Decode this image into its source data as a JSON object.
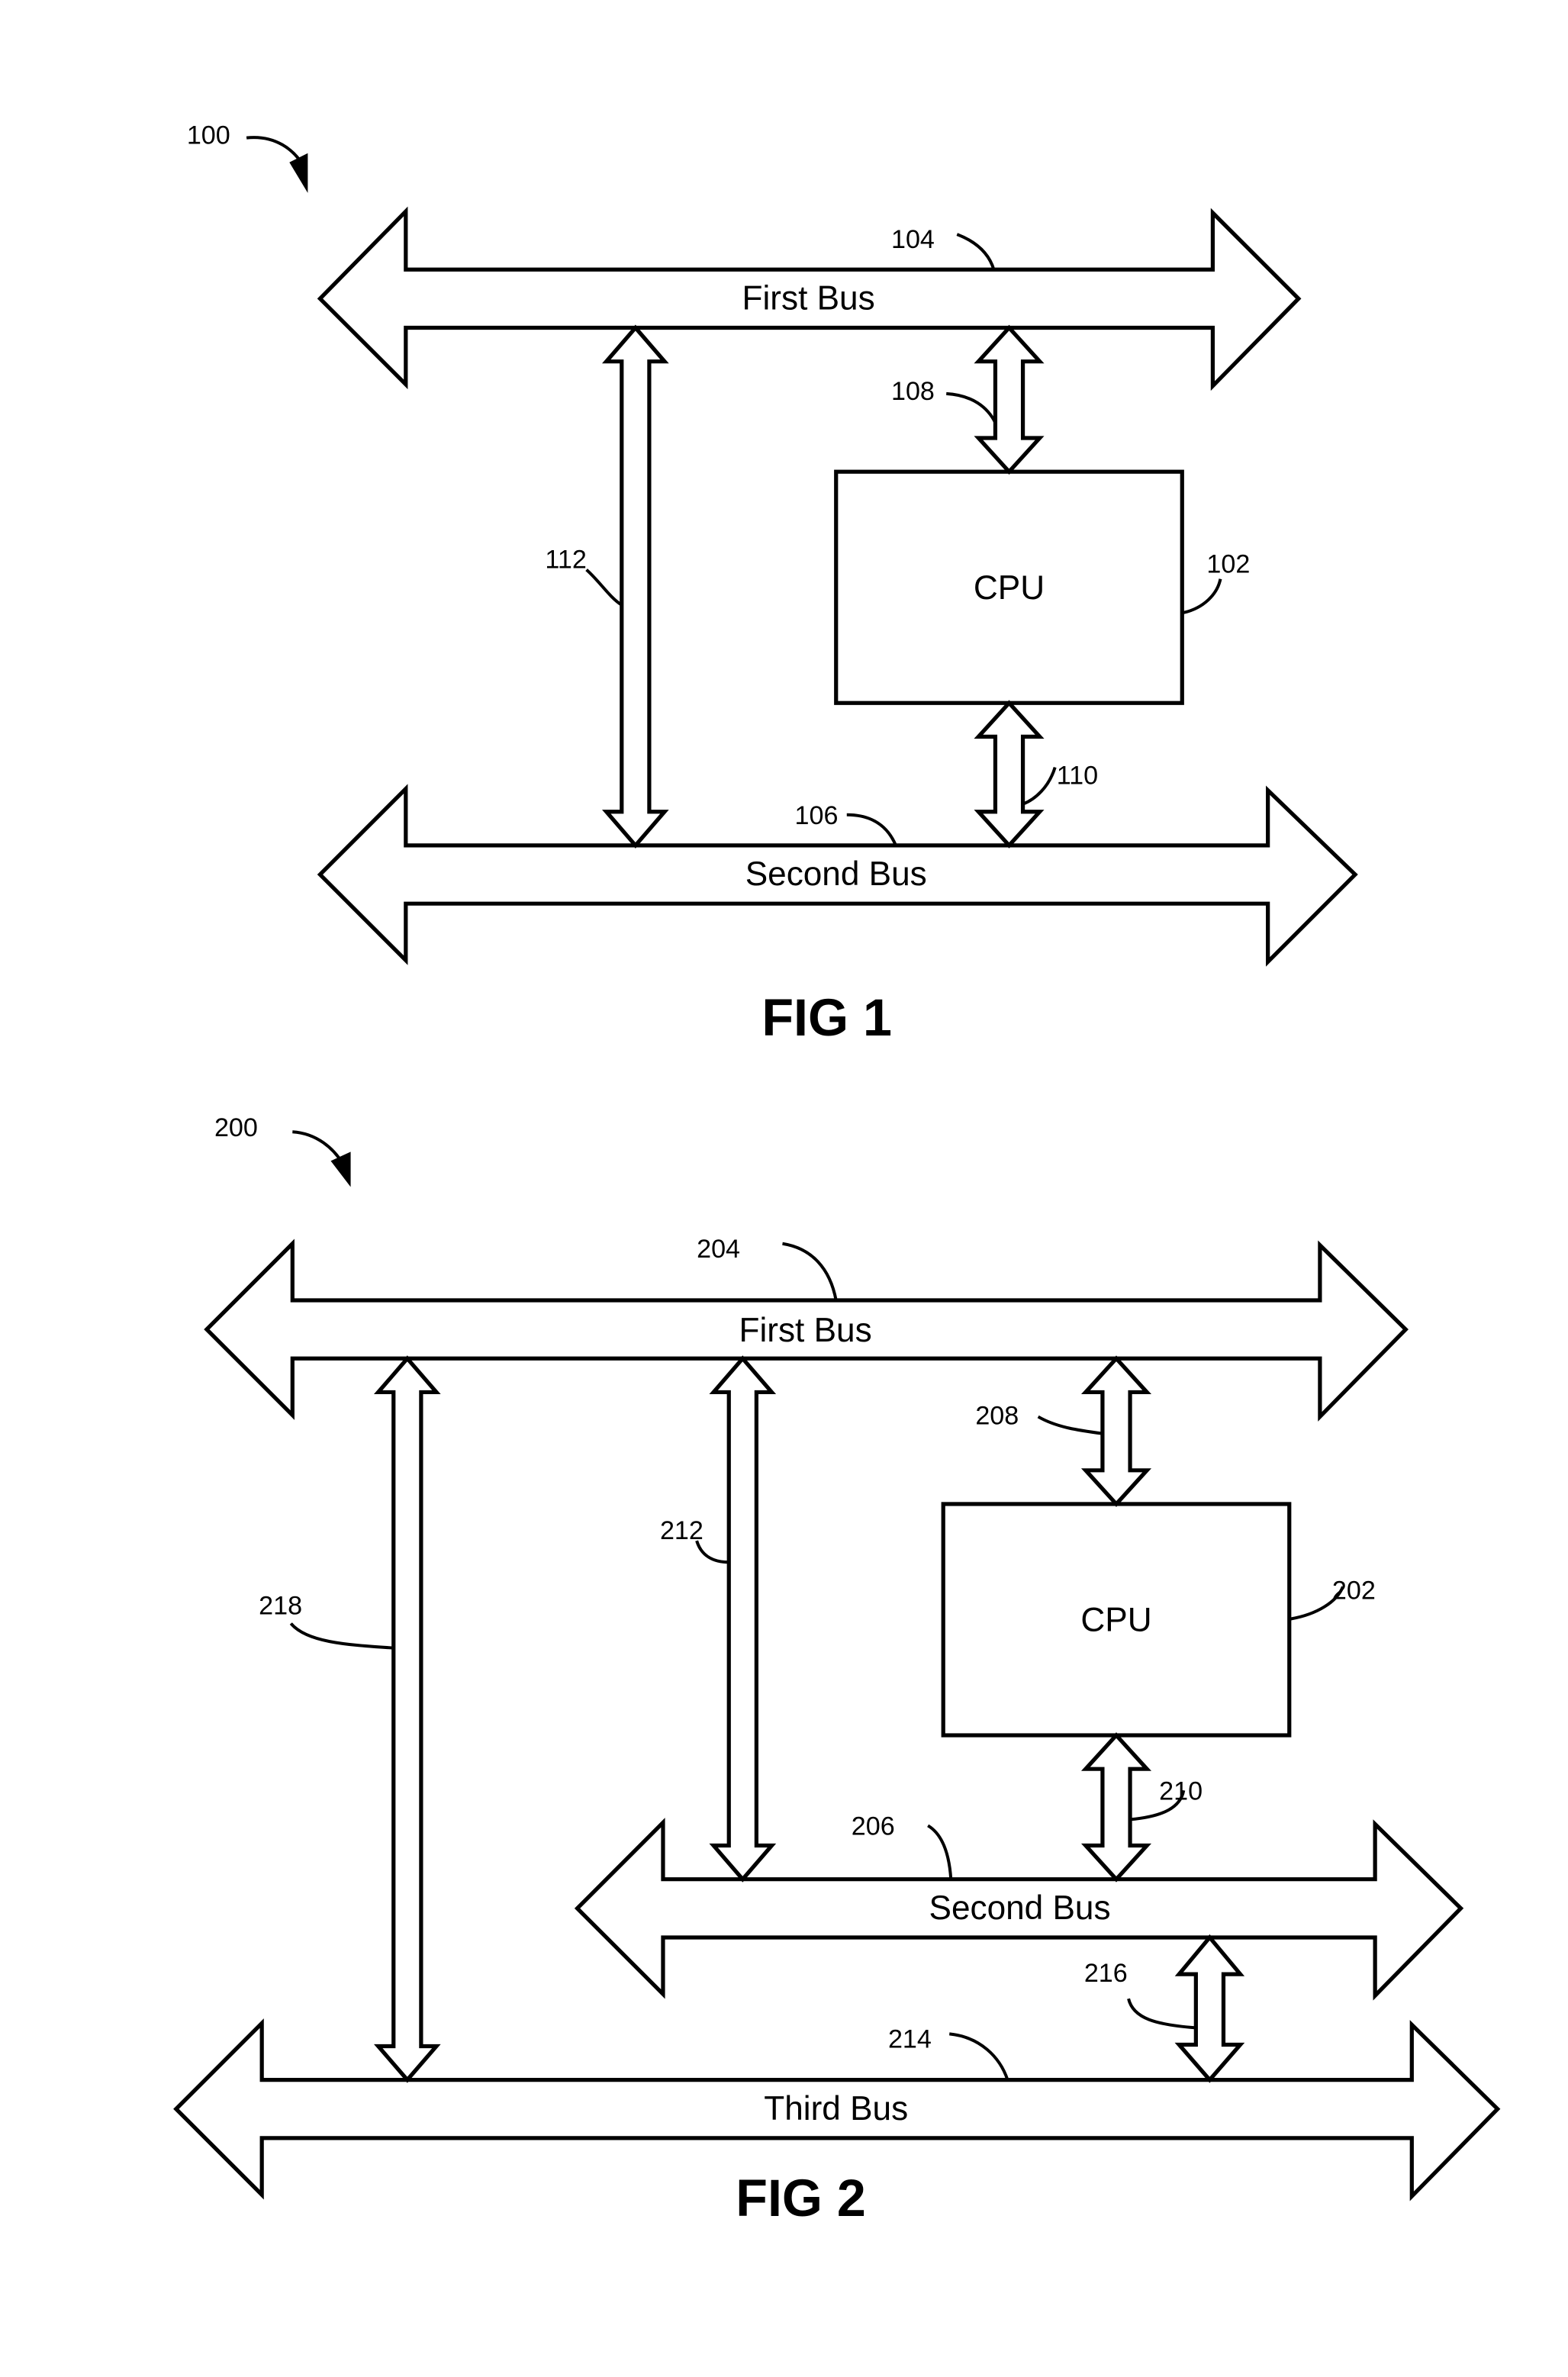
{
  "figures": [
    {
      "id": "fig1",
      "caption": "FIG 1",
      "system_ref": "100",
      "cpu": {
        "label": "CPU",
        "ref": "102"
      },
      "buses": [
        {
          "label": "First Bus",
          "ref": "104"
        },
        {
          "label": "Second Bus",
          "ref": "106"
        }
      ],
      "links": [
        {
          "ref": "108",
          "connects": "First Bus - CPU"
        },
        {
          "ref": "110",
          "connects": "CPU - Second Bus"
        },
        {
          "ref": "112",
          "connects": "First Bus - Second Bus"
        }
      ]
    },
    {
      "id": "fig2",
      "caption": "FIG 2",
      "system_ref": "200",
      "cpu": {
        "label": "CPU",
        "ref": "202"
      },
      "buses": [
        {
          "label": "First Bus",
          "ref": "204"
        },
        {
          "label": "Second Bus",
          "ref": "206"
        },
        {
          "label": "Third Bus",
          "ref": "214"
        }
      ],
      "links": [
        {
          "ref": "208",
          "connects": "First Bus - CPU"
        },
        {
          "ref": "210",
          "connects": "CPU - Second Bus"
        },
        {
          "ref": "212",
          "connects": "First Bus - Second Bus"
        },
        {
          "ref": "216",
          "connects": "Second Bus - Third Bus"
        },
        {
          "ref": "218",
          "connects": "First Bus - Third Bus"
        }
      ]
    }
  ]
}
